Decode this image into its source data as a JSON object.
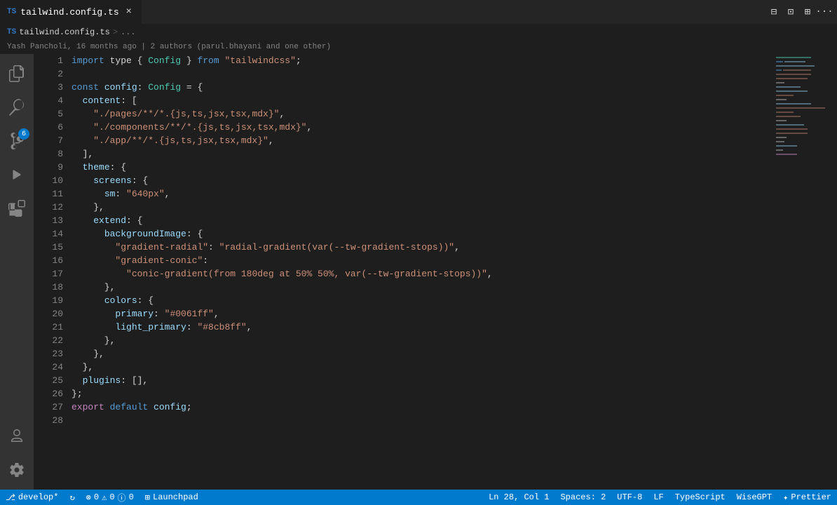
{
  "tab": {
    "icon": "TS",
    "filename": "tailwind.config.ts",
    "close_label": "×"
  },
  "breadcrumb": {
    "ts_label": "TS",
    "filename": "tailwind.config.ts",
    "sep": ">",
    "ellipsis": "..."
  },
  "git_info": {
    "author": "Yash Pancholi, 16 months ago  |  2 authors (parul.bhayani and one other)"
  },
  "activity": {
    "items": [
      {
        "icon": "⎔",
        "name": "explorer"
      },
      {
        "icon": "🔍",
        "name": "search"
      },
      {
        "icon": "⎇",
        "name": "source-control",
        "badge": "6"
      },
      {
        "icon": "▷",
        "name": "run"
      },
      {
        "icon": "⊞",
        "name": "extensions"
      },
      {
        "icon": "👤",
        "name": "account"
      },
      {
        "icon": "⚙",
        "name": "settings"
      }
    ]
  },
  "code": {
    "lines": [
      {
        "num": 1,
        "tokens": [
          {
            "t": "kw",
            "v": "import"
          },
          {
            "t": "punct",
            "v": " type "
          },
          {
            "t": "punct",
            "v": "{ "
          },
          {
            "t": "type",
            "v": "Config"
          },
          {
            "t": "punct",
            "v": " } "
          },
          {
            "t": "kw",
            "v": "from"
          },
          {
            "t": "punct",
            "v": " "
          },
          {
            "t": "str",
            "v": "\"tailwindcss\""
          },
          {
            "t": "punct",
            "v": ";"
          }
        ]
      },
      {
        "num": 2,
        "tokens": []
      },
      {
        "num": 3,
        "tokens": [
          {
            "t": "kw",
            "v": "const"
          },
          {
            "t": "punct",
            "v": " "
          },
          {
            "t": "var",
            "v": "config"
          },
          {
            "t": "punct",
            "v": ": "
          },
          {
            "t": "type",
            "v": "Config"
          },
          {
            "t": "punct",
            "v": " = {"
          }
        ]
      },
      {
        "num": 4,
        "tokens": [
          {
            "t": "punct",
            "v": "  "
          },
          {
            "t": "prop",
            "v": "content"
          },
          {
            "t": "punct",
            "v": ": ["
          }
        ]
      },
      {
        "num": 5,
        "tokens": [
          {
            "t": "punct",
            "v": "    "
          },
          {
            "t": "str",
            "v": "\"./pages/**/*.{js,ts,jsx,tsx,mdx}\""
          },
          {
            "t": "punct",
            "v": ","
          }
        ]
      },
      {
        "num": 6,
        "tokens": [
          {
            "t": "punct",
            "v": "    "
          },
          {
            "t": "str",
            "v": "\"./components/**/*.{js,ts,jsx,tsx,mdx}\""
          },
          {
            "t": "punct",
            "v": ","
          }
        ]
      },
      {
        "num": 7,
        "tokens": [
          {
            "t": "punct",
            "v": "    "
          },
          {
            "t": "str",
            "v": "\"./app/**/*.{js,ts,jsx,tsx,mdx}\""
          },
          {
            "t": "punct",
            "v": ","
          }
        ]
      },
      {
        "num": 8,
        "tokens": [
          {
            "t": "punct",
            "v": "  ],"
          }
        ]
      },
      {
        "num": 9,
        "tokens": [
          {
            "t": "punct",
            "v": "  "
          },
          {
            "t": "prop",
            "v": "theme"
          },
          {
            "t": "punct",
            "v": ": {"
          }
        ]
      },
      {
        "num": 10,
        "tokens": [
          {
            "t": "punct",
            "v": "    "
          },
          {
            "t": "prop",
            "v": "screens"
          },
          {
            "t": "punct",
            "v": ": {"
          }
        ]
      },
      {
        "num": 11,
        "tokens": [
          {
            "t": "punct",
            "v": "      "
          },
          {
            "t": "prop",
            "v": "sm"
          },
          {
            "t": "punct",
            "v": ": "
          },
          {
            "t": "str",
            "v": "\"640px\""
          },
          {
            "t": "punct",
            "v": ","
          }
        ]
      },
      {
        "num": 12,
        "tokens": [
          {
            "t": "punct",
            "v": "    },"
          }
        ]
      },
      {
        "num": 13,
        "tokens": [
          {
            "t": "punct",
            "v": "    "
          },
          {
            "t": "prop",
            "v": "extend"
          },
          {
            "t": "punct",
            "v": ": {"
          }
        ]
      },
      {
        "num": 14,
        "tokens": [
          {
            "t": "punct",
            "v": "      "
          },
          {
            "t": "prop",
            "v": "backgroundImage"
          },
          {
            "t": "punct",
            "v": ": {"
          }
        ]
      },
      {
        "num": 15,
        "tokens": [
          {
            "t": "punct",
            "v": "        "
          },
          {
            "t": "str",
            "v": "\"gradient-radial\""
          },
          {
            "t": "punct",
            "v": ": "
          },
          {
            "t": "str",
            "v": "\"radial-gradient(var(--tw-gradient-stops))\""
          },
          {
            "t": "punct",
            "v": ","
          }
        ]
      },
      {
        "num": 16,
        "tokens": [
          {
            "t": "punct",
            "v": "        "
          },
          {
            "t": "str",
            "v": "\"gradient-conic\""
          },
          {
            "t": "punct",
            "v": ":"
          }
        ]
      },
      {
        "num": 17,
        "tokens": [
          {
            "t": "punct",
            "v": "          "
          },
          {
            "t": "str",
            "v": "\"conic-gradient(from 180deg at 50% 50%, var(--tw-gradient-stops))\""
          },
          {
            "t": "punct",
            "v": ","
          }
        ]
      },
      {
        "num": 18,
        "tokens": [
          {
            "t": "punct",
            "v": "      },"
          }
        ]
      },
      {
        "num": 19,
        "tokens": [
          {
            "t": "punct",
            "v": "      "
          },
          {
            "t": "prop",
            "v": "colors"
          },
          {
            "t": "punct",
            "v": ": {"
          }
        ]
      },
      {
        "num": 20,
        "tokens": [
          {
            "t": "punct",
            "v": "        "
          },
          {
            "t": "prop",
            "v": "primary"
          },
          {
            "t": "punct",
            "v": ": "
          },
          {
            "t": "str",
            "v": "\"#0061ff\""
          },
          {
            "t": "punct",
            "v": ","
          }
        ]
      },
      {
        "num": 21,
        "tokens": [
          {
            "t": "punct",
            "v": "        "
          },
          {
            "t": "prop",
            "v": "light_primary"
          },
          {
            "t": "punct",
            "v": ": "
          },
          {
            "t": "str",
            "v": "\"#8cb8ff\""
          },
          {
            "t": "punct",
            "v": ","
          }
        ]
      },
      {
        "num": 22,
        "tokens": [
          {
            "t": "punct",
            "v": "      },"
          }
        ]
      },
      {
        "num": 23,
        "tokens": [
          {
            "t": "punct",
            "v": "    },"
          }
        ]
      },
      {
        "num": 24,
        "tokens": [
          {
            "t": "punct",
            "v": "  },"
          }
        ]
      },
      {
        "num": 25,
        "tokens": [
          {
            "t": "punct",
            "v": "  "
          },
          {
            "t": "prop",
            "v": "plugins"
          },
          {
            "t": "punct",
            "v": ": [],"
          }
        ]
      },
      {
        "num": 26,
        "tokens": [
          {
            "t": "punct",
            "v": "};"
          }
        ]
      },
      {
        "num": 27,
        "tokens": [
          {
            "t": "kw2",
            "v": "export"
          },
          {
            "t": "punct",
            "v": " "
          },
          {
            "t": "kw",
            "v": "default"
          },
          {
            "t": "punct",
            "v": " "
          },
          {
            "t": "var",
            "v": "config"
          },
          {
            "t": "punct",
            "v": ";"
          }
        ]
      },
      {
        "num": 28,
        "tokens": []
      }
    ]
  },
  "status_bar": {
    "branch": "develop*",
    "sync_icon": "↻",
    "errors": "0",
    "warnings": "0",
    "info": "0",
    "launchpad": "Launchpad",
    "ln": "Ln 28, Col 1",
    "spaces": "Spaces: 2",
    "encoding": "UTF-8",
    "eol": "LF",
    "language": "TypeScript",
    "wisegpt": "WiseGPT",
    "prettier": "Prettier"
  },
  "minimap_visible": true
}
